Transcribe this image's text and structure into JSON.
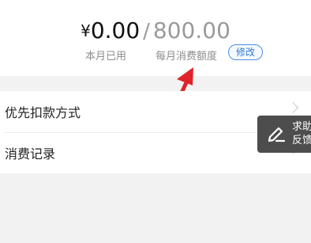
{
  "quota": {
    "currency_symbol": "¥",
    "used_amount": "0.00",
    "separator": "/",
    "monthly_limit": "800.00",
    "used_label": "本月已用",
    "limit_label": "每月消费额度",
    "edit_label": "修改"
  },
  "menu": {
    "items": [
      {
        "label": "优先扣款方式"
      },
      {
        "label": "消费记录"
      }
    ]
  },
  "feedback": {
    "line1": "求助",
    "line2": "反馈"
  },
  "colors": {
    "accent": "#2f7ad6",
    "arrow": "#e0232b",
    "feedback_bg": "#4d4d4d"
  },
  "icons": {
    "annotation": "arrow-icon",
    "row_chevron": "chevron-right-icon",
    "feedback": "pencil-icon"
  }
}
